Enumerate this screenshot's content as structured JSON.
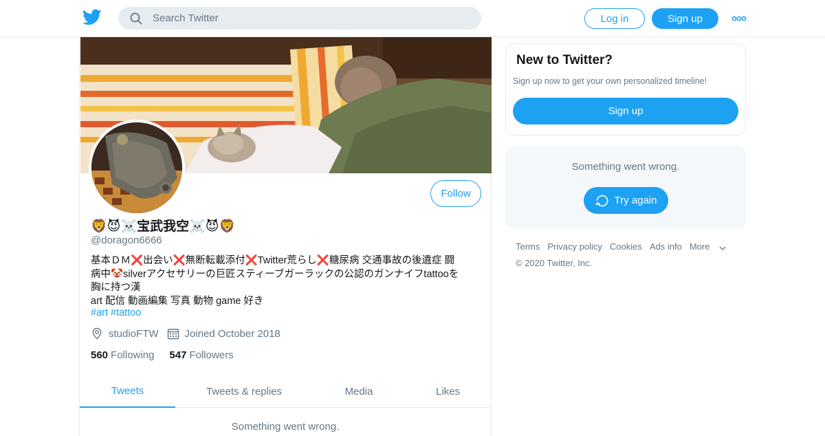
{
  "search": {
    "placeholder": "Search Twitter"
  },
  "header": {
    "login_label": "Log in",
    "signup_label": "Sign up"
  },
  "profile": {
    "follow_label": "Follow",
    "display_name": "🦁😈☠️宝武我空☠️😈🦁",
    "handle": "@doragon6666",
    "bio_lines": [
      "基本ＤＭ❌出会い❌無断転載添付❌Twitter荒らし❌糖尿病 交通事故の後遺症 闘",
      "病中🤡silverアクセサリーの巨匠スティーブガーラックの公認のガンナイフtattooを",
      "胸に持つ漢",
      "art 配信 動画編集 写真 動物 game 好き"
    ],
    "hashtags": "#art #tattoo",
    "location": "studioFTW",
    "joined": "Joined October 2018",
    "following_count": "560",
    "following_label": "Following",
    "followers_count": "547",
    "followers_label": "Followers"
  },
  "tabs": [
    {
      "label": "Tweets",
      "active": true
    },
    {
      "label": "Tweets & replies",
      "active": false
    },
    {
      "label": "Media",
      "active": false
    },
    {
      "label": "Likes",
      "active": false
    }
  ],
  "timeline_error": "Something went wrong.",
  "signup_card": {
    "title": "New to Twitter?",
    "subtitle": "Sign up now to get your own personalized timeline!",
    "button_label": "Sign up"
  },
  "error_card": {
    "message": "Something went wrong.",
    "button_label": "Try again"
  },
  "footer": {
    "links": [
      "Terms",
      "Privacy policy",
      "Cookies",
      "Ads info",
      "More"
    ],
    "copyright": "© 2020 Twitter, Inc."
  },
  "colors": {
    "accent": "#1da1f2",
    "muted": "#657786",
    "text": "#14171a",
    "border": "#e6ecf0"
  }
}
